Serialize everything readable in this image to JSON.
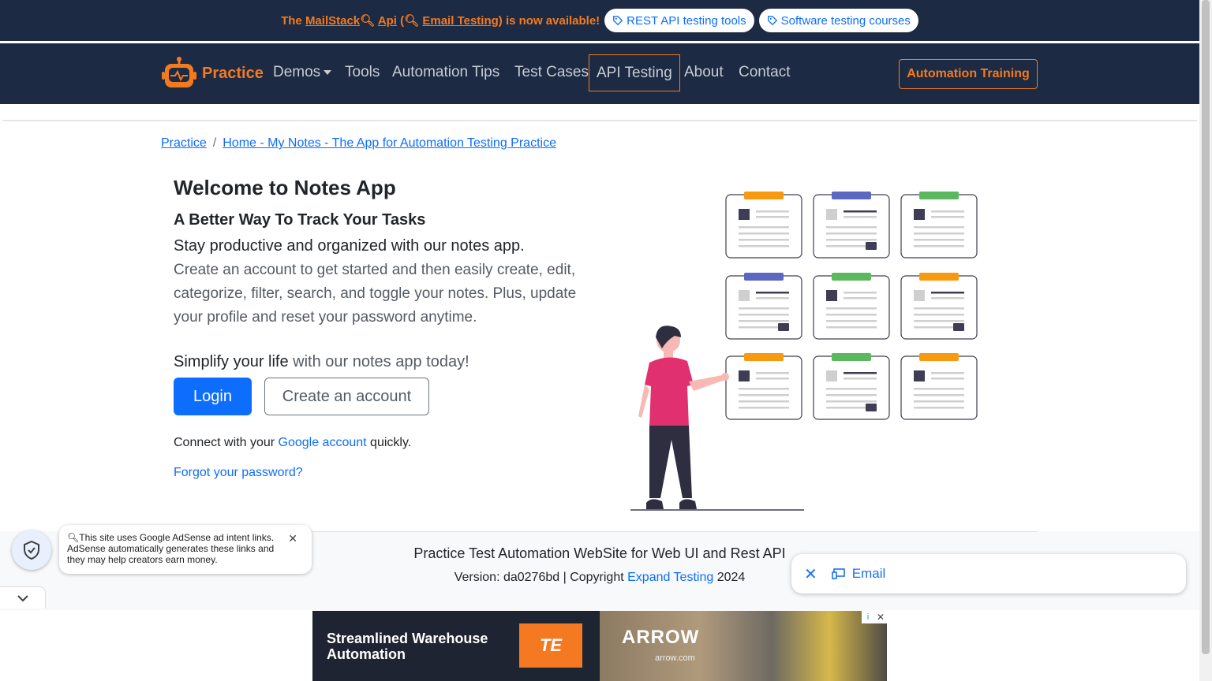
{
  "promo": {
    "prefix": "The ",
    "mailstack": "MailStack",
    "api": "Api",
    "paren_open": " (",
    "email_testing": "Email Testing",
    "suffix": ") is now available!",
    "pills": [
      "REST API testing tools",
      "Software testing courses"
    ]
  },
  "nav": {
    "brand": "Practice",
    "items": [
      "Demos",
      "Tools",
      "Automation Tips",
      "Test Cases",
      "API Testing",
      "About",
      "Contact"
    ],
    "training_button": "Automation Training"
  },
  "breadcrumb": {
    "root": "Practice",
    "separator": "/",
    "current": "Home - My Notes - The App for Automation Testing Practice"
  },
  "main": {
    "title": "Welcome to Notes App",
    "subtitle": "A Better Way To Track Your Tasks",
    "lead": "Stay productive and organized with our notes app.",
    "description": "Create an account to get started and then easily create, edit, categorize, filter, search, and toggle your notes. Plus, update your profile and reset your password anytime.",
    "simplify_strong": "Simplify your life",
    "simplify_rest": " with our notes app today!",
    "login_button": "Login",
    "create_button": "Create an account",
    "connect_prefix": "Connect with your ",
    "connect_link": "Google account",
    "connect_suffix": " quickly.",
    "forgot_link": "Forgot your password?"
  },
  "footer": {
    "title": "Practice Test Automation WebSite for Web UI and Rest API",
    "version_prefix": "Version: da0276bd | Copyright ",
    "company_link": "Expand Testing",
    "year": " 2024"
  },
  "adsense_notice": {
    "text": "This site uses Google AdSense ad intent links. AdSense automatically generates these links and they may help creators earn money."
  },
  "email_chip": {
    "label": "Email"
  },
  "ad": {
    "headline": "Streamlined Warehouse Automation",
    "logo_text": "TE",
    "brand": "ARROW",
    "brand_url": "arrow.com"
  },
  "colors": {
    "nav_bg": "#1c2a43",
    "accent_orange": "#f47a20",
    "link_blue": "#0d6efd"
  }
}
